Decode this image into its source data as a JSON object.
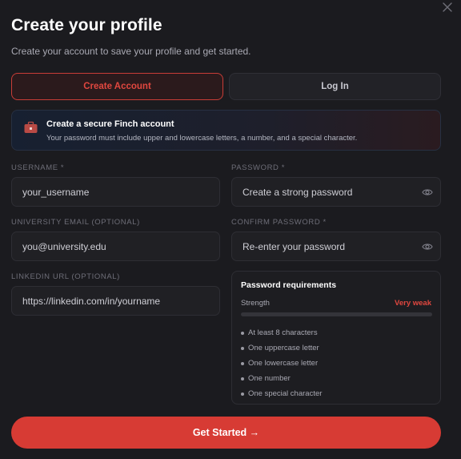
{
  "dialog": {
    "title": "Create your profile",
    "subtitle": "Create your account to save your profile and get started.",
    "close_icon": "close-icon"
  },
  "tabs": [
    {
      "label": "Create Account",
      "active": true
    },
    {
      "label": "Log In",
      "active": false
    }
  ],
  "info_banner": {
    "icon": "briefcase-icon",
    "title": "Create a secure Finch account",
    "text": "Your password must include upper and lowercase letters, a number, and a special character."
  },
  "form": {
    "username": {
      "label": "USERNAME *",
      "placeholder": "your_username"
    },
    "password": {
      "label": "PASSWORD *",
      "placeholder": "Create a strong password"
    },
    "email": {
      "label": "UNIVERSITY EMAIL (OPTIONAL)",
      "placeholder": "you@university.edu"
    },
    "confirm_password": {
      "label": "CONFIRM PASSWORD *",
      "placeholder": "Re-enter your password"
    },
    "linkedin": {
      "label": "LINKEDIN URL (OPTIONAL)",
      "placeholder": "https://linkedin.com/in/yourname"
    }
  },
  "requirements": {
    "title": "Password requirements",
    "strength_label": "Strength",
    "strength_value": "Very weak",
    "strength_fraction": 0,
    "items": [
      "At least 8 characters",
      "One uppercase letter",
      "One lowercase letter",
      "One number",
      "One special character"
    ]
  },
  "cta": {
    "label": "Get Started →"
  },
  "colors": {
    "accent": "#d73b34",
    "background": "#1b1b1f",
    "field": "#202024"
  }
}
